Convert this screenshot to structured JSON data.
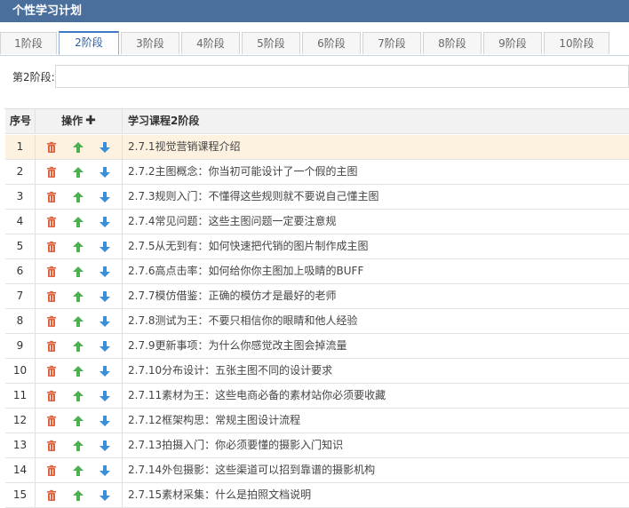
{
  "window": {
    "title": "个性学习计划"
  },
  "tabs": [
    "1阶段",
    "2阶段",
    "3阶段",
    "4阶段",
    "5阶段",
    "6阶段",
    "7阶段",
    "8阶段",
    "9阶段",
    "10阶段"
  ],
  "active_tab_index": 1,
  "stage_field": {
    "label": "第2阶段:",
    "value": ""
  },
  "table": {
    "headers": {
      "no": "序号",
      "ops": "操作",
      "course": "学习课程2阶段"
    },
    "icons": {
      "delete": "trash-icon",
      "up": "arrow-up-icon",
      "down": "arrow-down-icon",
      "add": "plus-icon"
    },
    "colors": {
      "delete": "#e0603a",
      "up": "#4caf50",
      "down": "#3b8fd9",
      "selected_row": "#fdf1e0"
    },
    "selected_row_index": 0,
    "rows": [
      {
        "no": "1",
        "course": "2.7.1视觉营销课程介绍"
      },
      {
        "no": "2",
        "course": "2.7.2主图概念：你当初可能设计了一个假的主图"
      },
      {
        "no": "3",
        "course": "2.7.3规则入门：不懂得这些规则就不要说自己懂主图"
      },
      {
        "no": "4",
        "course": "2.7.4常见问题：这些主图问题一定要注意规"
      },
      {
        "no": "5",
        "course": "2.7.5从无到有：如何快速把代销的图片制作成主图"
      },
      {
        "no": "6",
        "course": "2.7.6高点击率：如何给你你主图加上吸睛的BUFF"
      },
      {
        "no": "7",
        "course": "2.7.7模仿借鉴：正确的模仿才是最好的老师"
      },
      {
        "no": "8",
        "course": "2.7.8测试为王：不要只相信你的眼睛和他人经验"
      },
      {
        "no": "9",
        "course": "2.7.9更新事项：为什么你感觉改主图会掉流量"
      },
      {
        "no": "10",
        "course": "2.7.10分布设计：五张主图不同的设计要求"
      },
      {
        "no": "11",
        "course": "2.7.11素材为王：这些电商必备的素材站你必须要收藏"
      },
      {
        "no": "12",
        "course": "2.7.12框架构思：常规主图设计流程"
      },
      {
        "no": "13",
        "course": "2.7.13拍摄入门：你必须要懂的摄影入门知识"
      },
      {
        "no": "14",
        "course": "2.7.14外包摄影：这些渠道可以招到靠谱的摄影机构"
      },
      {
        "no": "15",
        "course": "2.7.15素材采集：什么是拍照文档说明"
      }
    ]
  }
}
